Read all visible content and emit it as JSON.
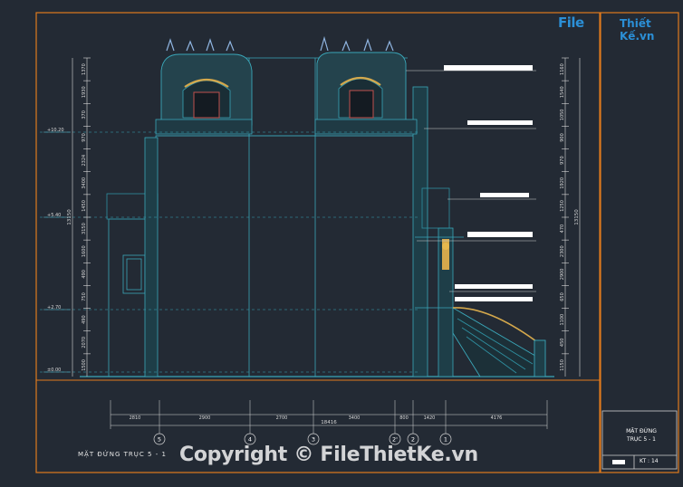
{
  "brand": {
    "name_part1": "File",
    "name_part2": "Thiết Kế.vn"
  },
  "watermark": "Copyright © FileThietKe.vn",
  "drawing": {
    "title": "MẶT ĐỨNG TRỤC 5 - 1",
    "title_block_line1": "MẶT ĐỨNG",
    "title_block_line2": "TRỤC 5 - 1",
    "sheet": "KT : 14"
  },
  "levels": [
    "+10.20",
    "+5.40",
    "+2.70",
    "±0.00"
  ],
  "left_dims": [
    "1370",
    "1930",
    "370",
    "970",
    "2324",
    "3400",
    "1450",
    "3150",
    "1600",
    "490",
    "750",
    "490",
    "2070",
    "1500"
  ],
  "left_total": "13150",
  "right_dims": [
    "1160",
    "1540",
    "1050",
    "900",
    "970",
    "1920",
    "1250",
    "470",
    "2300",
    "2900",
    "650",
    "1100",
    "450",
    "1150"
  ],
  "right_total": "13150",
  "bottom_dims": [
    "2810",
    "2900",
    "2700",
    "3400",
    "800",
    "1420",
    "4176"
  ],
  "bottom_total": "18416",
  "axes": [
    "5",
    "4",
    "3",
    "2'",
    "2",
    "1"
  ],
  "colors": {
    "background": "#232a34",
    "frame": "#e07a1e",
    "line": "#3aa6b8",
    "ornament": "#d4a84c",
    "dim": "#d8d8d8"
  }
}
